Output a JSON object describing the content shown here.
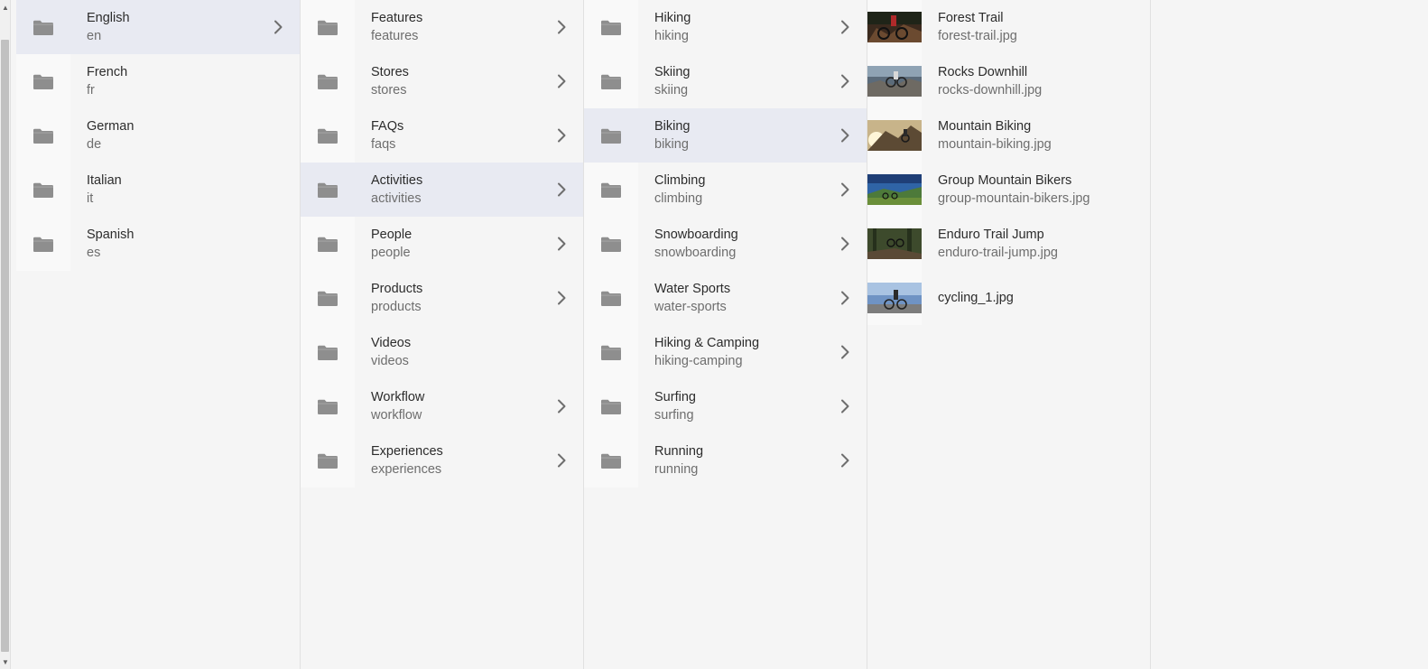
{
  "columns": [
    {
      "items": [
        {
          "title": "English",
          "subtitle": "en",
          "selected": true,
          "has_children": true
        },
        {
          "title": "French",
          "subtitle": "fr",
          "selected": false,
          "has_children": false
        },
        {
          "title": "German",
          "subtitle": "de",
          "selected": false,
          "has_children": false
        },
        {
          "title": "Italian",
          "subtitle": "it",
          "selected": false,
          "has_children": false
        },
        {
          "title": "Spanish",
          "subtitle": "es",
          "selected": false,
          "has_children": false
        }
      ]
    },
    {
      "items": [
        {
          "title": "Features",
          "subtitle": "features",
          "selected": false,
          "has_children": true
        },
        {
          "title": "Stores",
          "subtitle": "stores",
          "selected": false,
          "has_children": true
        },
        {
          "title": "FAQs",
          "subtitle": "faqs",
          "selected": false,
          "has_children": true
        },
        {
          "title": "Activities",
          "subtitle": "activities",
          "selected": true,
          "has_children": true
        },
        {
          "title": "People",
          "subtitle": "people",
          "selected": false,
          "has_children": true
        },
        {
          "title": "Products",
          "subtitle": "products",
          "selected": false,
          "has_children": true
        },
        {
          "title": "Videos",
          "subtitle": "videos",
          "selected": false,
          "has_children": false
        },
        {
          "title": "Workflow",
          "subtitle": "workflow",
          "selected": false,
          "has_children": true
        },
        {
          "title": "Experiences",
          "subtitle": "experiences",
          "selected": false,
          "has_children": true
        }
      ]
    },
    {
      "items": [
        {
          "title": "Hiking",
          "subtitle": "hiking",
          "selected": false,
          "has_children": true
        },
        {
          "title": "Skiing",
          "subtitle": "skiing",
          "selected": false,
          "has_children": true
        },
        {
          "title": "Biking",
          "subtitle": "biking",
          "selected": true,
          "has_children": true
        },
        {
          "title": "Climbing",
          "subtitle": "climbing",
          "selected": false,
          "has_children": true
        },
        {
          "title": "Snowboarding",
          "subtitle": "snowboarding",
          "selected": false,
          "has_children": true
        },
        {
          "title": "Water Sports",
          "subtitle": "water-sports",
          "selected": false,
          "has_children": true
        },
        {
          "title": "Hiking & Camping",
          "subtitle": "hiking-camping",
          "selected": false,
          "has_children": true
        },
        {
          "title": "Surfing",
          "subtitle": "surfing",
          "selected": false,
          "has_children": true
        },
        {
          "title": "Running",
          "subtitle": "running",
          "selected": false,
          "has_children": true
        }
      ]
    }
  ],
  "assets": [
    {
      "title": "Forest Trail",
      "subtitle": "forest-trail.jpg",
      "thumb": "forest"
    },
    {
      "title": "Rocks Downhill",
      "subtitle": "rocks-downhill.jpg",
      "thumb": "rocks"
    },
    {
      "title": "Mountain Biking",
      "subtitle": "mountain-biking.jpg",
      "thumb": "mountain"
    },
    {
      "title": "Group Mountain Bikers",
      "subtitle": "group-mountain-bikers.jpg",
      "thumb": "group"
    },
    {
      "title": "Enduro Trail Jump",
      "subtitle": "enduro-trail-jump.jpg",
      "thumb": "enduro"
    },
    {
      "title": "",
      "subtitle": "cycling_1.jpg",
      "thumb": "cycling"
    }
  ],
  "colors": {
    "selected_bg": "#e8eaf2",
    "folder_icon": "#8e8e8e",
    "chevron": "#6e6e6e"
  }
}
